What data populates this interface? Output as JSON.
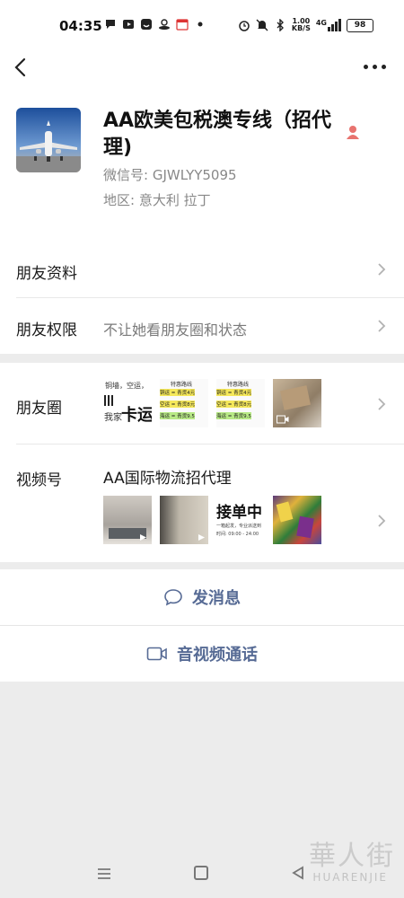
{
  "status_bar": {
    "time": "04:35",
    "net_speed_value": "1.00",
    "net_speed_unit": "KB/S",
    "network": "4G",
    "battery": "98",
    "icons": [
      "message-icon",
      "video-icon",
      "app-icon",
      "app-icon",
      "calendar-icon",
      "dot-icon",
      "alarm-icon",
      "mute-icon",
      "bluetooth-icon",
      "signal-icon"
    ]
  },
  "nav": {
    "back_icon": "chevron-left-icon",
    "more_icon": "more-dots-icon"
  },
  "profile": {
    "name": "AA欧美包税澳专线（招代理)",
    "wechat_id_label": "微信号: GJWLYY5095",
    "region_label": "地区: 意大利  拉丁",
    "gender_icon": "female-icon"
  },
  "rows": {
    "friend_info": {
      "label": "朋友资料"
    },
    "friend_permissions": {
      "label": "朋友权限",
      "value": "不让她看朋友圈和状态"
    },
    "moments": {
      "label": "朋友圈"
    },
    "channels": {
      "label": "视频号",
      "channel_name": "AA国际物流招代理"
    }
  },
  "moments_thumbs": {
    "t1": {
      "line1": "铜墙，空运，",
      "line2": "我家",
      "big": "卡运"
    },
    "t2": {
      "title": "特惠路线",
      "l1": "铜运 = 青货4元",
      "l2": "空运 = 青货8元",
      "l3": "海运 = 青货9.5"
    },
    "t3": {
      "title": "特惠路线",
      "l1": "铜运 = 青货4元",
      "l2": "空运 = 青货8元",
      "l3": "海运 = 青货9.5"
    }
  },
  "channel_thumbs": {
    "t3": {
      "big": "接单中",
      "small1": "一箱起发，专业派送到",
      "small2": "时间: 09:00 - 24:00"
    }
  },
  "actions": {
    "send_message": "发消息",
    "video_call": "音视频通话"
  },
  "watermark": {
    "main": "華人街",
    "sub": "HUARENJIE"
  },
  "colors": {
    "accent": "#576b95",
    "background": "#ececec",
    "female": "#e8736f"
  }
}
